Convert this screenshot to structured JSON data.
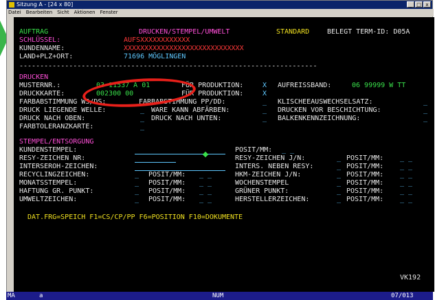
{
  "window": {
    "title": "Sitzung A - [24 x 80]",
    "buttons": [
      "_",
      "□",
      "x"
    ]
  },
  "menu": [
    "Datei",
    "Bearbeiten",
    "Sicht",
    "Aktionen",
    "Fenster"
  ],
  "header": {
    "auftrag": "AUFTRAG",
    "screen_title": "DRUCKEN/STEMPEL/UMWELT",
    "mode": "STANDARD",
    "belegt": "BELEGT TERM-ID: D05A",
    "schluessel_label": "SCHLÜSSEL:",
    "schluessel_value": "AUFSXXXXXXXXXXXX",
    "kundenname_label": "KUNDENNAME:",
    "kundenname_value": "XXXXXXXXXXXXXXXXXXXXXXXXXXXXX",
    "ort_label": "LAND+PLZ+ORT:",
    "ort_value": "71696 MÖGLINGEN",
    "separator": "------------------------------------------------------------------------"
  },
  "drucken": {
    "section": "DRUCKEN",
    "musternr_label": "MUSTERNR.:",
    "musternr_value": "03 11537 A 01",
    "fuer_prod1_label": "FÜR PRODUKTION:",
    "fuer_prod1_value": "X",
    "aufreissband_label": "AUFREISSBAND:",
    "aufreissband_value": "06 99999 W TT",
    "druckkarte_label": "DRUCKKARTE:",
    "druckkarte_value": "002300 00",
    "fuer_prod2_label": "FÜR PRODUKTION:",
    "fuer_prod2_value": "X",
    "farbabst_ws_label": "FARBABSTIMMUNG WS/DS:",
    "farbabst_pp_label": "FARBABSTIMMUNG PP/DD:",
    "klischee_label": "KLISCHEEAUSWECHSELSATZ:",
    "druck_welle_label": "DRUCK LIEGENDE WELLE:",
    "ware_label": "WARE KANN ABFÄRBEN:",
    "drucken_vor_label": "DRUCKEN VOR BESCHICHTUNG:",
    "druck_oben_label": "DRUCK NACH OBEN:",
    "druck_unten_label": "DRUCK NACH UNTEN:",
    "balken_label": "BALKENKENNZEICHNUNG:",
    "farbtoleranz_label": "FARBTOLERANZKARTE:",
    "underscore": "_"
  },
  "stempel": {
    "section": "STEMPEL/ENTSORGUNG",
    "kundenstempel": "KUNDENSTEMPEL:",
    "resy_nr": "RESY-ZEICHEN NR:",
    "interseroh": "INTERSEROH-ZEICHEN:",
    "recycling": "RECYCLINGZEICHEN:",
    "monatsstempel": "MONATSSTEMPEL:",
    "haftung": "HAFTUNG GR. PUNKT:",
    "umwelt": "UMWELTZEICHEN:",
    "posit": "POSIT/MM:",
    "resy_jn": "RESY-ZEICHEN J/N:",
    "inters_neben": "INTERS. NEBEN RESY:",
    "hkm_jn": "HKM-ZEICHEN J/N:",
    "wochenstempel": "WOCHENSTEMPEL",
    "gruener": "GRÜNER PUNKT:",
    "hersteller": "HERSTELLERZEICHEN:",
    "blank": "_",
    "blank_pair": "_ _"
  },
  "footer": {
    "keys": "DAT.FRG=SPEICH F1=CS/CP/PP F6=POSITION F10=DOKUMENTE",
    "screen_id": "VK192"
  },
  "statusbar": {
    "session": "MA",
    "field": "a",
    "mode": "NUM",
    "cursor": "07/013"
  },
  "colors": {
    "green": "#39e04a",
    "cyan": "#5fc8ff",
    "magenta": "#ff4fd8",
    "yellow": "#f0e020",
    "red_circle": "#e8201a"
  }
}
